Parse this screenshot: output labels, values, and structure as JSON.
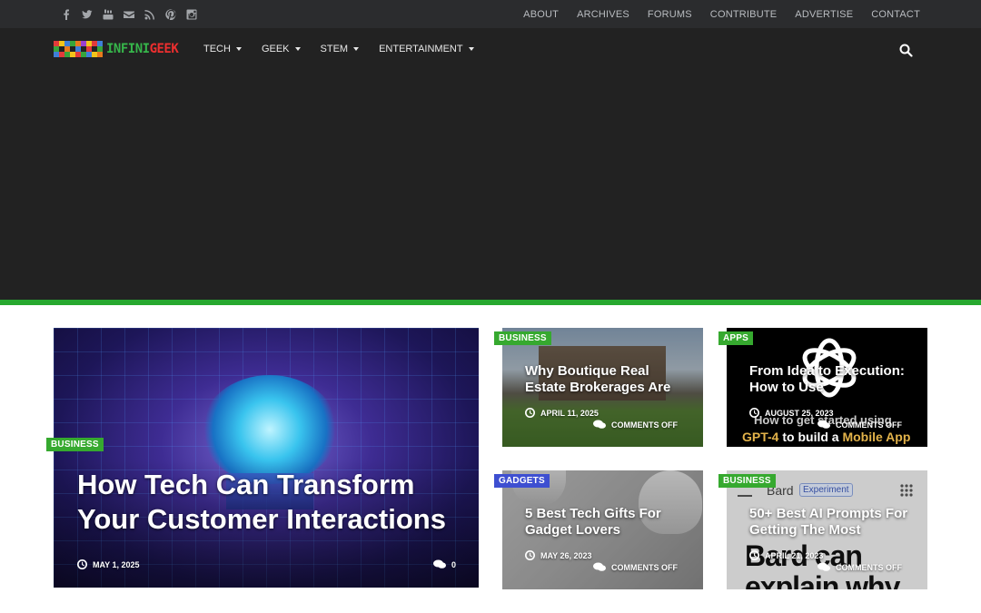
{
  "topbar": {
    "social_icons": [
      "facebook-icon",
      "twitter-icon",
      "youtube-icon",
      "email-icon",
      "rss-icon",
      "pinterest-icon",
      "instagram-icon"
    ],
    "links": [
      "ABOUT",
      "ARCHIVES",
      "FORUMS",
      "CONTRIBUTE",
      "ADVERTISE",
      "CONTACT"
    ]
  },
  "header": {
    "logo": {
      "part1": "INFINI",
      "part2": "GEEK"
    },
    "nav": [
      "TECH",
      "GEEK",
      "STEM",
      "ENTERTAINMENT"
    ],
    "search_icon": "search-icon"
  },
  "colors": {
    "accent_green": "#27a82f",
    "category_green": "#36a92f",
    "category_blue": "#3e4fd1",
    "topbar_bg": "#2b2c2e",
    "header_bg": "#222222"
  },
  "featured": {
    "category": "BUSINESS",
    "title": "How Tech Can Transform Your Customer Interactions",
    "date": "MAY 1, 2025",
    "comments": "0"
  },
  "cards": [
    {
      "category": "BUSINESS",
      "title": "Why Boutique Real Estate Brokerages Are",
      "date": "APRIL 11, 2025",
      "comments": "COMMENTS OFF"
    },
    {
      "category": "APPS",
      "title": "From Idea to Execution: How to Use",
      "date": "AUGUST 25, 2023",
      "comments": "COMMENTS OFF",
      "image_text": {
        "line1": "How to get started using",
        "line2a": "GPT-4",
        "line2b": " to build a ",
        "line2c": "Mobile App"
      }
    },
    {
      "category": "GADGETS",
      "title": "5 Best Tech Gifts For Gadget Lovers",
      "date": "MAY 26, 2023",
      "comments": "COMMENTS OFF"
    },
    {
      "category": "BUSINESS",
      "title": "50+ Best AI Prompts For Getting The Most",
      "date": "APRIL 21, 2023",
      "comments": "COMMENTS OFF",
      "image_text": {
        "app": "Bard",
        "badge": "Experiment",
        "big": "Bard can",
        "big2": "explain why"
      }
    }
  ]
}
